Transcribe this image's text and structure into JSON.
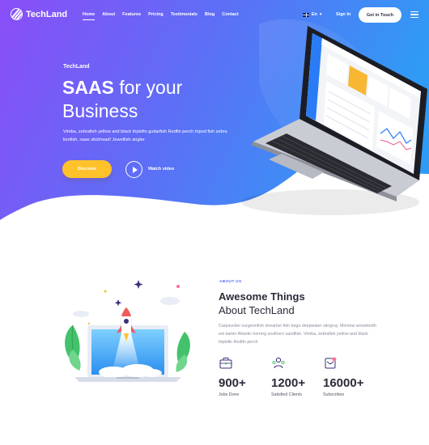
{
  "brand": {
    "name": "TechLand"
  },
  "nav": {
    "items": [
      {
        "label": "Home",
        "active": true
      },
      {
        "label": "About"
      },
      {
        "label": "Features"
      },
      {
        "label": "Pricing"
      },
      {
        "label": "Testimonials"
      },
      {
        "label": "Blog"
      },
      {
        "label": "Contact"
      }
    ],
    "language": "En",
    "signin": "Sign In",
    "cta": "Get in Touch"
  },
  "hero": {
    "eyebrow": "TechLand",
    "headline_bold": "SAAS",
    "headline_rest": " for your",
    "headline_line2": "Business",
    "subtitle": "Vimba, zebrafish yellow and black triplefin guitarfish Redfin perch tripod fish zebra lionfish, nase slickhead! Jewelfish angler",
    "discover": "Discover",
    "watch": "Watch video"
  },
  "about": {
    "eyebrow": "ABOUT US",
    "title": "Awesome Things",
    "title2": "About TechLand",
    "text": "Carpsucker surgeonfish streamer fish boga deepwater stingray. Minnow arrowtooth eel darter Atlantic herring southern sandfish. Vimba, zebrafish yellow and black triplefin Redfin perch",
    "stats": [
      {
        "value": "900+",
        "label": "Jobs Done",
        "icon": "briefcase-icon"
      },
      {
        "value": "1200+",
        "label": "Satisfied Clients",
        "icon": "users-icon"
      },
      {
        "value": "16000+",
        "label": "Subscribes",
        "icon": "subscribe-icon"
      }
    ]
  },
  "colors": {
    "hero_start": "#8a4df7",
    "hero_end": "#2f9bf5",
    "accent_yellow": "#ffc22b",
    "about_accent": "#5b6cf0"
  }
}
